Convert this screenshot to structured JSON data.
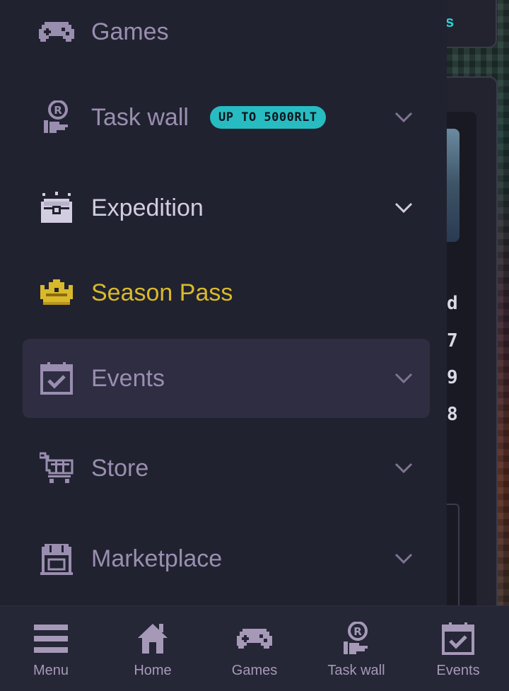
{
  "colors": {
    "drawer_bg": "#212230",
    "active_bg": "#2e2d42",
    "muted_text": "#9a8eb0",
    "gold": "#d9b92a",
    "badge": "#27bcc2"
  },
  "drawer": {
    "items": [
      {
        "label": "Games",
        "icon": "gamepad-icon",
        "has_chevron": false
      },
      {
        "label": "Task wall",
        "icon": "coin-hand-icon",
        "badge": "UP TO 5000RLT",
        "has_chevron": true
      },
      {
        "label": "Expedition",
        "icon": "chest-icon",
        "has_chevron": true
      },
      {
        "label": "Season Pass",
        "icon": "crown-icon",
        "has_chevron": false
      },
      {
        "label": "Events",
        "icon": "calendar-check-icon",
        "has_chevron": true,
        "active": true
      },
      {
        "label": "Store",
        "icon": "cart-icon",
        "has_chevron": true
      },
      {
        "label": "Marketplace",
        "icon": "shop-icon",
        "has_chevron": true
      }
    ]
  },
  "background": {
    "visible_chars": [
      "d",
      "7",
      "9",
      "8"
    ]
  },
  "bottom_nav": {
    "items": [
      {
        "label": "Menu",
        "icon": "hamburger-icon"
      },
      {
        "label": "Home",
        "icon": "house-icon"
      },
      {
        "label": "Games",
        "icon": "gamepad-icon"
      },
      {
        "label": "Task wall",
        "icon": "coin-hand-icon"
      },
      {
        "label": "Events",
        "icon": "calendar-check-icon"
      }
    ]
  }
}
